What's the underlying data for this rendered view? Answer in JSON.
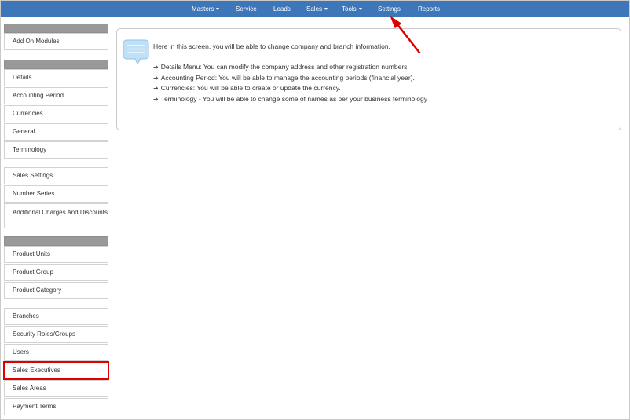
{
  "topnav": {
    "items": [
      {
        "label": "Masters",
        "dropdown": true
      },
      {
        "label": "Service",
        "dropdown": false
      },
      {
        "label": "Leads",
        "dropdown": false
      },
      {
        "label": "Sales",
        "dropdown": true
      },
      {
        "label": "Tools",
        "dropdown": true
      },
      {
        "label": "Settings",
        "dropdown": false
      },
      {
        "label": "Reports",
        "dropdown": false
      }
    ],
    "color": "#3d77b9"
  },
  "sidebar": {
    "groups": [
      {
        "header": true,
        "items": [
          "Add On Modules"
        ]
      },
      {
        "header": true,
        "items": [
          "Details",
          "Accounting Period",
          "Currencies",
          "General",
          "Terminology"
        ]
      },
      {
        "header": false,
        "items": [
          "Sales Settings",
          "Number Series",
          "Additional Charges And Discounts"
        ]
      },
      {
        "header": true,
        "items": [
          "Product Units",
          "Product Group",
          "Product Category"
        ]
      },
      {
        "header": false,
        "items": [
          "Branches",
          "Security Roles/Groups",
          "Users",
          "Sales Executives",
          "Sales Areas",
          "Payment Terms"
        ]
      }
    ],
    "highlighted_item": "Sales Executives",
    "highlight_color": "#e00000"
  },
  "info": {
    "icon": "speech-bubble-icon",
    "intro": "Here in this screen, you will be able to change company and branch information.",
    "bullet_icon": "arrow-right-icon",
    "bullets": [
      "Details Menu: You can modify the company address and other registration numbers",
      "Accounting Period: You will be able to manage the accounting periods (financial year).",
      "Currencies: You will be able to create or update the currency.",
      "Terminology - You will be able to change some of names as per your business terminology"
    ]
  },
  "annotation": {
    "icon": "red-pointer-arrow-icon",
    "color": "#e00000",
    "points_to": "Settings"
  }
}
